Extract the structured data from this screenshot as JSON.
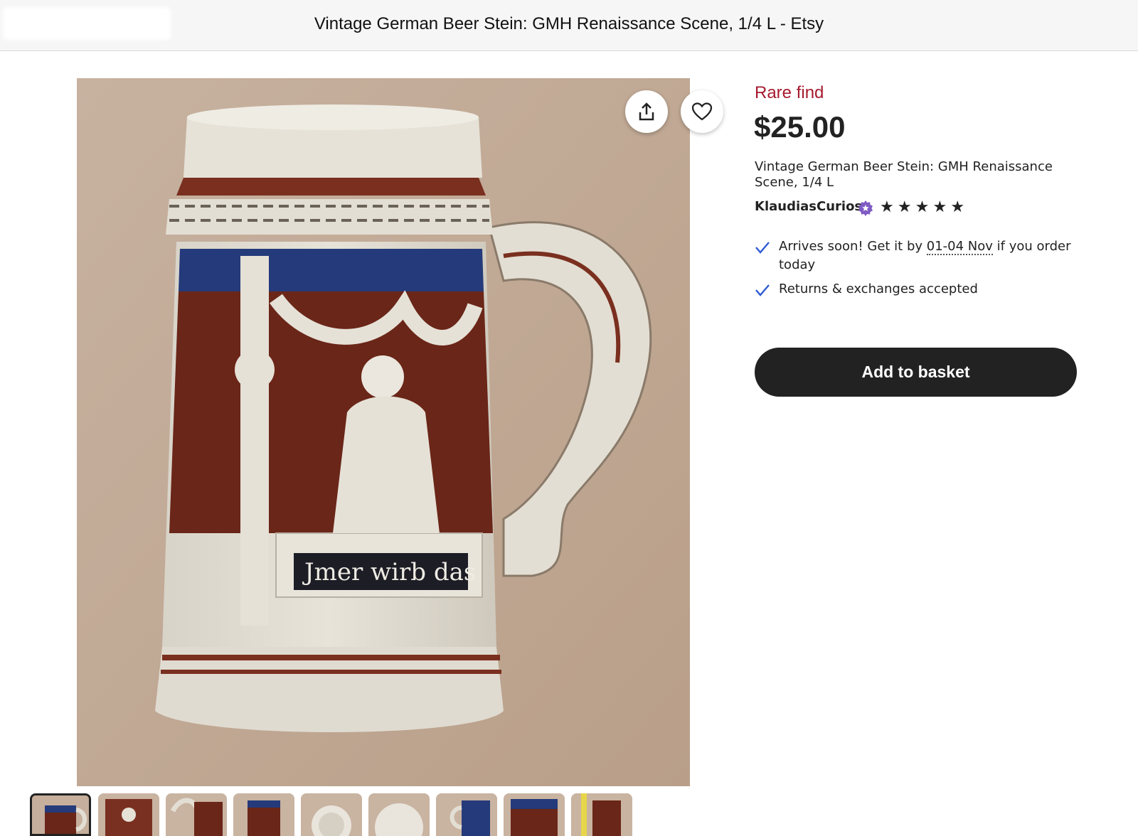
{
  "window": {
    "title": "Vintage German Beer Stein: GMH Renaissance Scene, 1/4 L - Etsy"
  },
  "photo": {
    "inscription": "Jmer wirb das"
  },
  "listing": {
    "badge": "Rare find",
    "price": "$25.00",
    "title": "Vintage German Beer Stein: GMH Renaissance Scene, 1/4 L",
    "shop_name": "KlaudiasCurios",
    "rating_stars": 5,
    "stars_text": [
      "★",
      "★",
      "★",
      "★",
      "★"
    ],
    "delivery_prefix": "Arrives soon! Get it by ",
    "delivery_date": "01-04 Nov",
    "delivery_suffix": " if you order today",
    "returns": "Returns & exchanges accepted",
    "add_to_basket": "Add to basket"
  },
  "icons": [
    "share-icon",
    "heart-icon",
    "check-icon",
    "star-seller-icon",
    "star-icon"
  ],
  "colors": {
    "accent_rare": "#a61a2e",
    "button_bg": "#222222",
    "check": "#2f5bd3",
    "star_seller": "#7f5bc4"
  }
}
